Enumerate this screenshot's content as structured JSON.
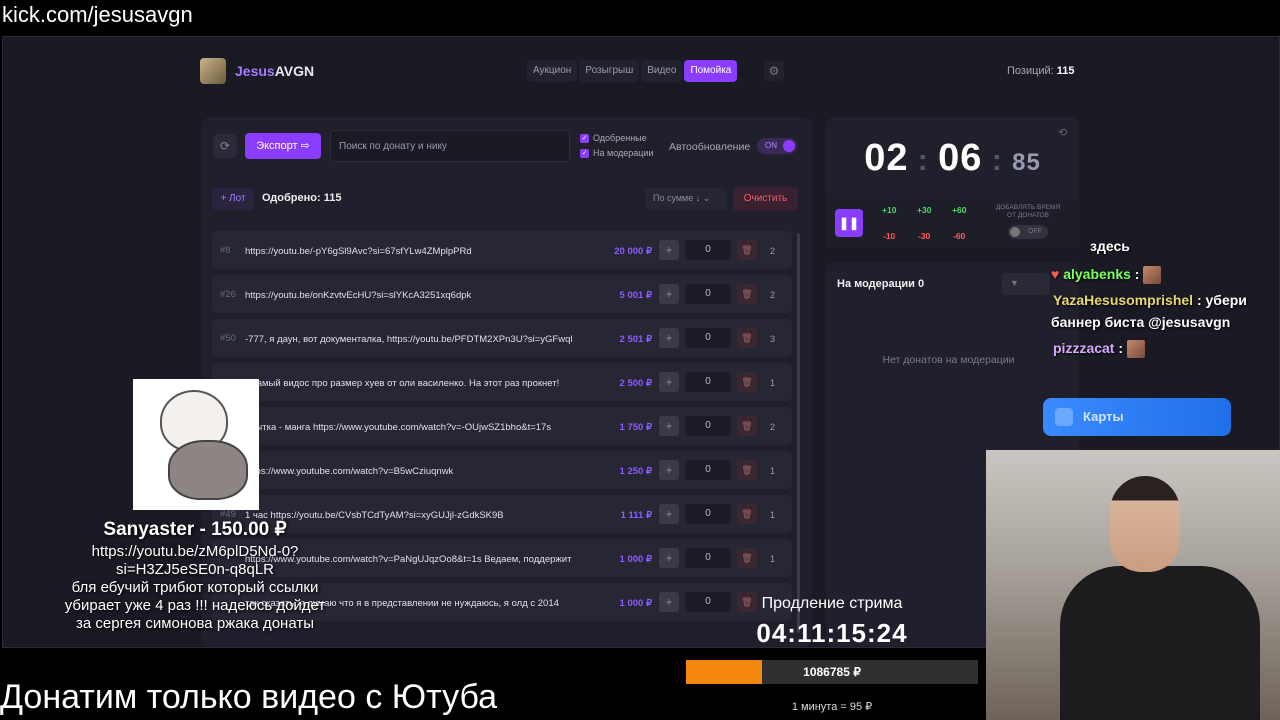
{
  "browser": {
    "url": "kick.com/jesusavgn"
  },
  "header": {
    "brand_a": "Jesus",
    "brand_b": "AVGN",
    "tabs": [
      "Аукцион",
      "Розыгрыш",
      "Видео",
      "Помойка"
    ],
    "active_tab": "Помойка",
    "positions_label": "Позиций:",
    "positions_value": "115"
  },
  "toolbar": {
    "export_label": "Экспорт",
    "search_placeholder": "Поиск по донату и нику",
    "chk_approved": "Одобренные",
    "chk_moderation": "На модерации",
    "autoupdate_label": "Автообновление",
    "autoupdate_state": "ON"
  },
  "listheader": {
    "lot_label": "+ Лот",
    "approved_label": "Одобрено: 115",
    "sort_label": "По сумме ↓",
    "clear_label": "Очистить"
  },
  "rows": [
    {
      "num": "#8",
      "text": "https://youtu.be/-pY6gSl9Avc?si=67sfYLw4ZMplpPRd",
      "amount": "20 000 ₽",
      "qty": "0",
      "count": "2"
    },
    {
      "num": "#26",
      "text": "https://youtu.be/onKzvtvEcHU?si=slYKcA3251xq6dpk",
      "amount": "5 001 ₽",
      "qty": "0",
      "count": "2"
    },
    {
      "num": "#50",
      "text": "-777, я даун, вот документалка, https://youtu.be/PFDTM2XPn3U?si=yGFwql",
      "amount": "2 501 ₽",
      "qty": "0",
      "count": "3"
    },
    {
      "num": "",
      "text": "т самый видос про размер хуев от оли василенко. На этот раз прокнет!",
      "amount": "2 500 ₽",
      "qty": "0",
      "count": "1"
    },
    {
      "num": "",
      "text": "опытка - манга https://www.youtube.com/watch?v=-OUjwSZ1bho&t=17s",
      "amount": "1 750 ₽",
      "qty": "0",
      "count": "2"
    },
    {
      "num": "",
      "text": "https://www.youtube.com/watch?v=B5wCziuqnwk",
      "amount": "1 250 ₽",
      "qty": "0",
      "count": "1"
    },
    {
      "num": "#49",
      "text": "1 час https://youtu.be/CVsbTCdTyAM?si=xyGUJjl-zGdkSK9B",
      "amount": "1 111 ₽",
      "qty": "0",
      "count": "1"
    },
    {
      "num": "",
      "text": "https://www.youtube.com/watch?v=PaNgUJqzOo8&t=1s Ведаем, поддержит",
      "amount": "1 000 ₽",
      "qty": "0",
      "count": "1"
    },
    {
      "num": "",
      "text": "так сказать, я думаю что я в представлении не нуждаюсь, я олд с 2014",
      "amount": "1 000 ₽",
      "qty": "0",
      "count": ""
    }
  ],
  "timer": {
    "mm": "02",
    "ss": "06",
    "ms": "85"
  },
  "timeadd": {
    "plus": [
      "+10",
      "+30",
      "+60"
    ],
    "minus": [
      "-10",
      "-30",
      "-60"
    ],
    "add_label": "ДОБАВЛЯТЬ ВРЕМЯ ОТ ДОНАТОВ",
    "off_label": "OFF"
  },
  "moderation": {
    "title": "На модерации",
    "count": "0",
    "empty": "Нет донатов на модерации"
  },
  "chat": [
    {
      "user": "alyabenks",
      "sep": " :",
      "msg": "",
      "color": "#7cff5a"
    },
    {
      "user": "YazaHesusomprishel",
      "sep": " : ",
      "msg": "убери",
      "color": "#e8d870"
    },
    {
      "user": "",
      "sep": "",
      "msg": "баннер биста @jesusavgn",
      "color": "#fff"
    },
    {
      "user": "pizzzacat",
      "sep": " :",
      "msg": "",
      "color": "#d8a8ff"
    }
  ],
  "chat_partial": "здесь",
  "cards_label": "Карты",
  "donation": {
    "name": "Sanyaster - 150.00 ₽",
    "message_1": "https://youtu.be/zM6plD5Nd-0?",
    "message_2": "si=H3ZJ5eSE0n-q8qLR",
    "message_3": "бля ебучий трибют который ссылки",
    "message_4": "убирает уже 4 раз !!! надеюсь дойдет",
    "message_5": "за сергея симонова ржака донаты"
  },
  "extension": {
    "label": "Продление стрима",
    "time": "04:11:15:24"
  },
  "progress": {
    "value": "1086785 ₽",
    "fraction": 0.26
  },
  "rate": "1 минута = 95 ₽",
  "banner": "Донатим только видео с Ютуба",
  "colors": {
    "accent": "#8b3dff",
    "amount": "#8b5cff",
    "progress": "#f5860f"
  }
}
